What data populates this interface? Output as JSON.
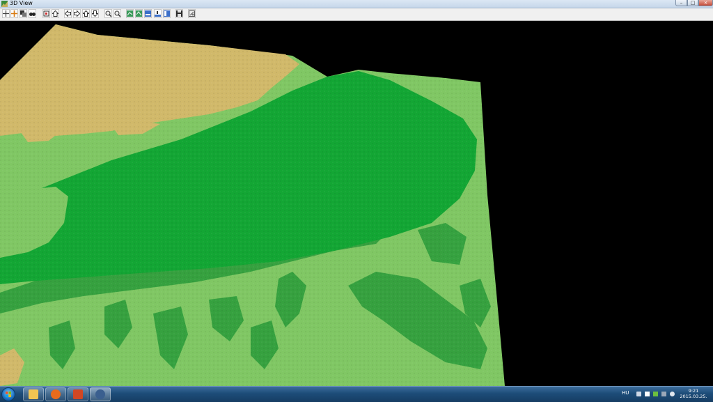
{
  "window": {
    "title": "3D View",
    "controls": {
      "minimize": "–",
      "maximize": "□",
      "close": "×"
    }
  },
  "toolbar": {
    "buttons": [
      {
        "icon": "pan-icon"
      },
      {
        "icon": "move-icon"
      },
      {
        "icon": "copy-icon"
      },
      {
        "icon": "binoculars-icon"
      },
      {
        "icon": "frame-icon"
      },
      {
        "icon": "home-icon"
      },
      {
        "icon": "arrow-left-icon"
      },
      {
        "icon": "arrow-right-icon"
      },
      {
        "icon": "arrow-up-icon"
      },
      {
        "icon": "arrow-down-icon"
      },
      {
        "icon": "zoom-in-icon"
      },
      {
        "icon": "zoom-out-icon"
      },
      {
        "icon": "surface-icon-1"
      },
      {
        "icon": "surface-icon-2"
      },
      {
        "icon": "layer-icon-1"
      },
      {
        "icon": "layer-icon-2"
      },
      {
        "icon": "layer-icon-3"
      },
      {
        "icon": "save-icon"
      },
      {
        "icon": "settings-icon"
      }
    ]
  },
  "viewport": {
    "colors": {
      "background": "#000000",
      "water": "#13a634",
      "lowland": "#80c764",
      "lowland_dark": "#2e9d3c",
      "highland": "#d1b96a"
    }
  },
  "taskbar": {
    "apps": [
      {
        "icon": "folder-icon",
        "color": "#f2c552"
      },
      {
        "icon": "firefox-icon",
        "color": "#e86b1c"
      },
      {
        "icon": "powerpoint-icon",
        "color": "#d14724"
      },
      {
        "icon": "globe-app-icon",
        "color": "#3a5f8f"
      }
    ],
    "tray": {
      "language": "HU",
      "time": "9:21",
      "date": "2015.03.25."
    }
  }
}
